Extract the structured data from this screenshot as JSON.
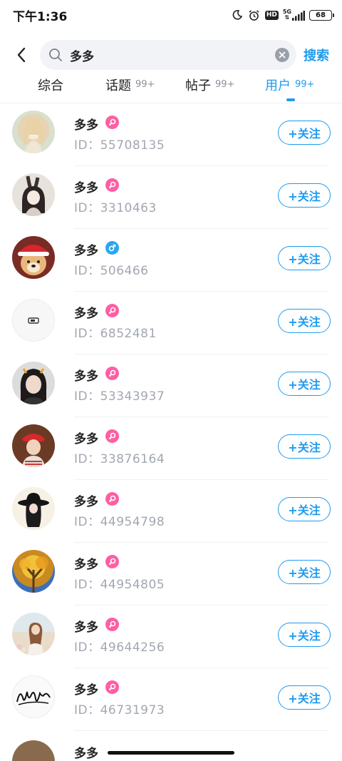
{
  "status_bar": {
    "time": "下午1:36",
    "network": "5G",
    "hd": "HD",
    "battery": "68"
  },
  "search": {
    "query": "多多",
    "submit_label": "搜索"
  },
  "tabs": [
    {
      "label": "综合",
      "count": ""
    },
    {
      "label": "话题",
      "count": "99+"
    },
    {
      "label": "帖子",
      "count": "99+"
    },
    {
      "label": "用户",
      "count": "99+",
      "active": true
    }
  ],
  "colors": {
    "accent": "#1e9bf0",
    "female_badge": "#ff5ea3",
    "male_badge": "#27a7f0"
  },
  "follow_label": "+关注",
  "users": [
    {
      "name": "多多",
      "id": "ID：55708135",
      "gender": "female",
      "avatar": "avatar-anime-girl"
    },
    {
      "name": "多多",
      "id": "ID：3310463",
      "gender": "female",
      "avatar": "avatar-anime-bunny"
    },
    {
      "name": "多多",
      "id": "ID：506466",
      "gender": "male",
      "avatar": "avatar-dog-santa-hat"
    },
    {
      "name": "多多",
      "id": "ID：6852481",
      "gender": "female",
      "avatar": "avatar-default"
    },
    {
      "name": "多多",
      "id": "ID：53343937",
      "gender": "female",
      "avatar": "avatar-person-photo"
    },
    {
      "name": "多多",
      "id": "ID：33876164",
      "gender": "female",
      "avatar": "avatar-girl-red-hat"
    },
    {
      "name": "多多",
      "id": "ID：44954798",
      "gender": "female",
      "avatar": "avatar-black-hat-silhouette"
    },
    {
      "name": "多多",
      "id": "ID：44954805",
      "gender": "female",
      "avatar": "avatar-autumn-tree"
    },
    {
      "name": "多多",
      "id": "ID：49644256",
      "gender": "female",
      "avatar": "avatar-girl-flowers"
    },
    {
      "name": "多多",
      "id": "ID：46731973",
      "gender": "female",
      "avatar": "avatar-signature"
    }
  ],
  "partial_user": {
    "name": "多多"
  }
}
